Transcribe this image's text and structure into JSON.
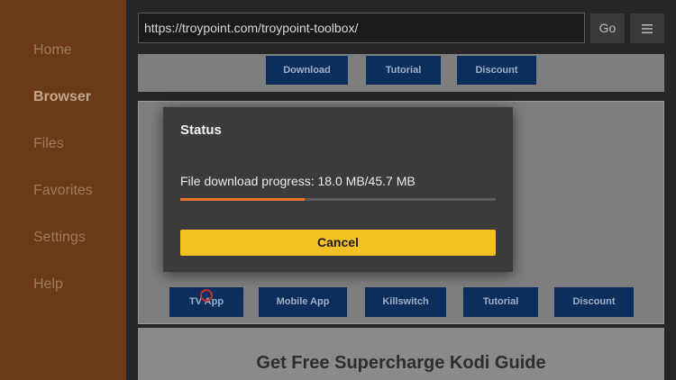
{
  "sidebar": {
    "items": [
      {
        "label": "Home",
        "active": false
      },
      {
        "label": "Browser",
        "active": true
      },
      {
        "label": "Files",
        "active": false
      },
      {
        "label": "Favorites",
        "active": false
      },
      {
        "label": "Settings",
        "active": false
      },
      {
        "label": "Help",
        "active": false
      }
    ]
  },
  "toolbar": {
    "url": "https://troypoint.com/troypoint-toolbox/",
    "go_label": "Go",
    "menu_icon": "hamburger-menu-icon"
  },
  "webpage": {
    "top_buttons": [
      "Download",
      "Tutorial",
      "Discount"
    ],
    "bottom_buttons": [
      "TV App",
      "Mobile App",
      "Killswitch",
      "Tutorial",
      "Discount"
    ],
    "heading": "Get Free Supercharge Kodi Guide"
  },
  "dialog": {
    "title": "Status",
    "progress_text": "File download progress: 18.0 MB/45.7 MB",
    "progress_fraction": 0.394,
    "cancel_label": "Cancel"
  },
  "colors": {
    "sidebar_bg": "#6b3a16",
    "accent_progress": "#e8712d",
    "cancel_button": "#f4c124",
    "web_button": "#0c2e5c"
  }
}
